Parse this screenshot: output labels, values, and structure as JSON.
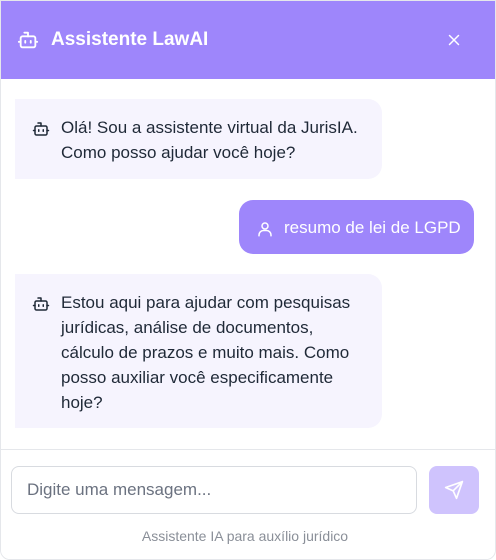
{
  "header": {
    "title": "Assistente LawAI",
    "icon": "bot-icon",
    "close_icon": "close-icon",
    "background": "#9e86fb"
  },
  "messages": [
    {
      "role": "assistant",
      "icon": "bot-icon",
      "text": "Olá! Sou a assistente virtual da JurisIA.\nComo posso ajudar você hoje?"
    },
    {
      "role": "user",
      "icon": "user-icon",
      "text": "resumo de lei de LGPD"
    },
    {
      "role": "assistant",
      "icon": "bot-icon",
      "text": "Estou aqui para ajudar com pesquisas\njurídicas, análise de documentos,\ncálculo de prazos e muito mais. Como\nposso auxiliar você especificamente\nhoje?"
    }
  ],
  "composer": {
    "placeholder": "Digite uma mensagem...",
    "value": "",
    "send_icon": "send-icon"
  },
  "footer": {
    "note": "Assistente IA para auxílio jurídico"
  },
  "colors": {
    "accent": "#9e86fb",
    "bot_bubble": "#f6f4fe",
    "send_disabled": "#cfc3fd"
  }
}
